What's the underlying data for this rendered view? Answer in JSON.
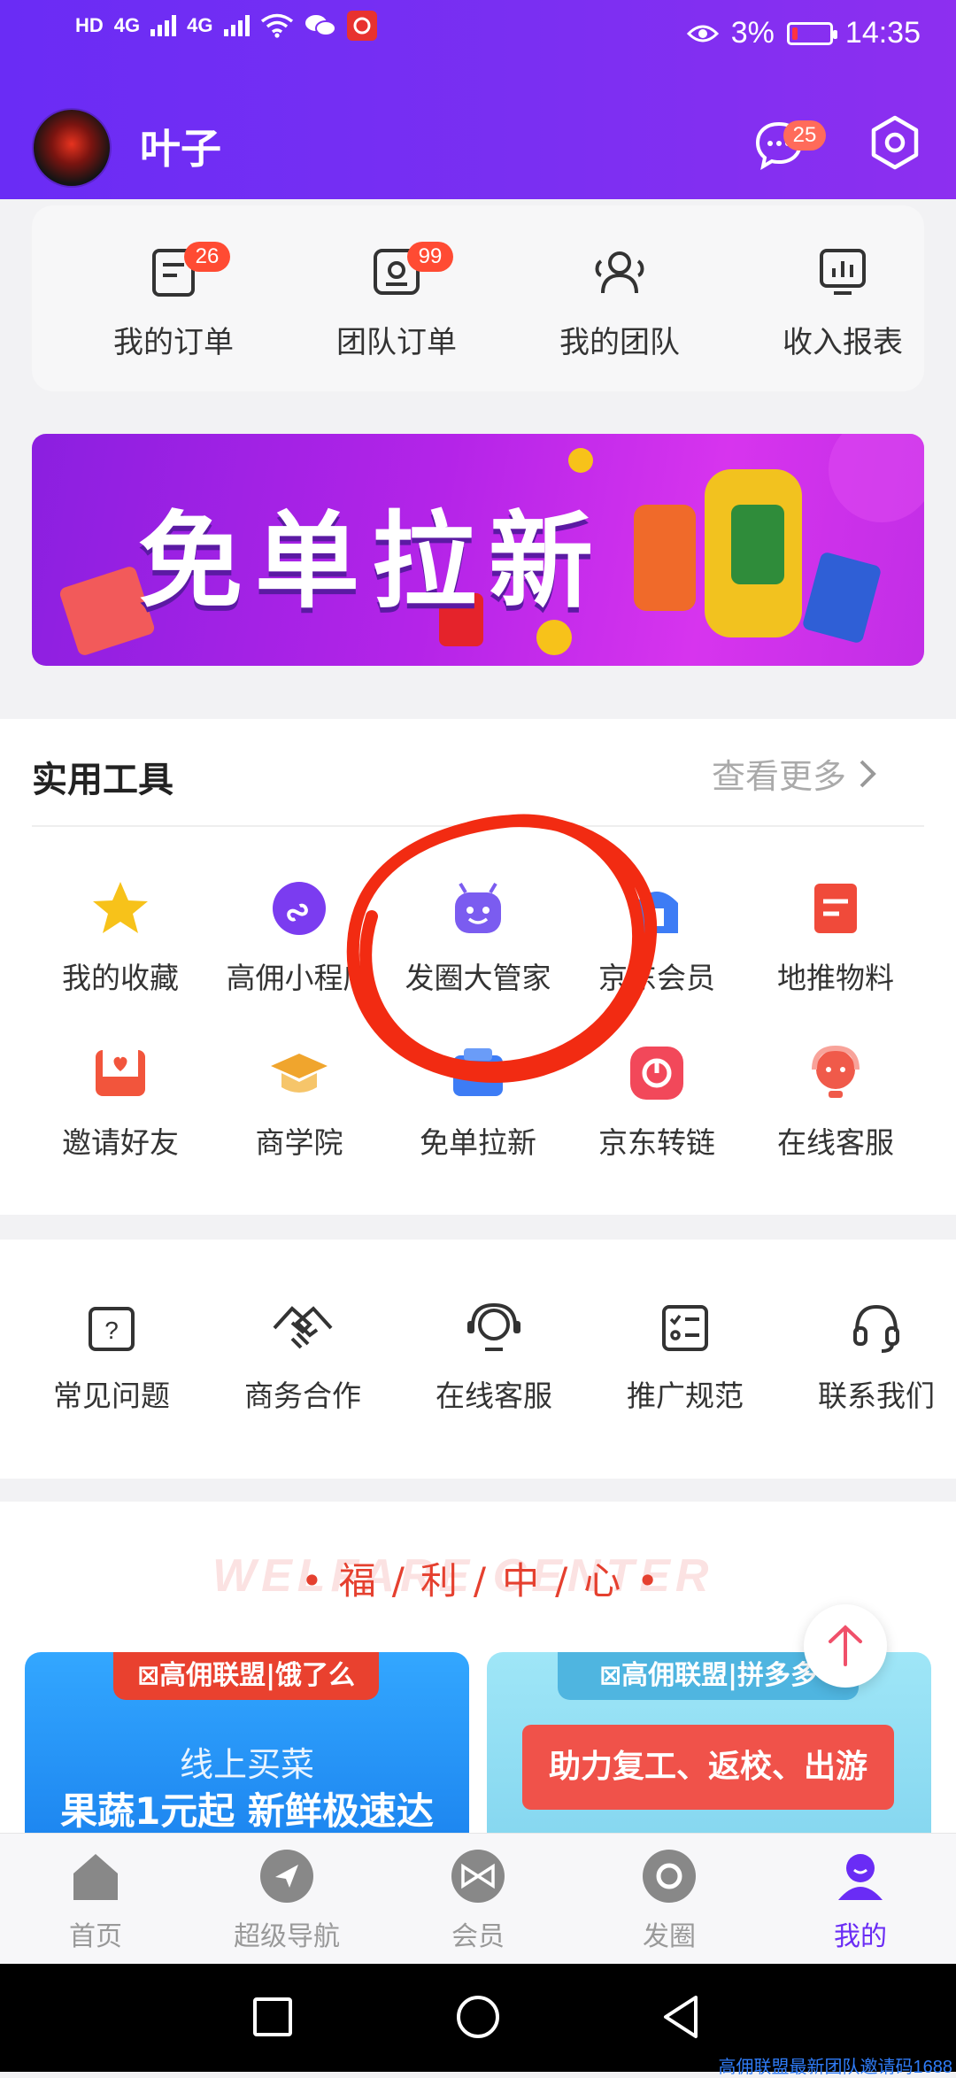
{
  "status_bar": {
    "network": [
      "HD",
      "4G",
      "4G"
    ],
    "battery": "3%",
    "time": "14:35"
  },
  "header": {
    "username": "叶子",
    "message_count": "25"
  },
  "orders": [
    {
      "label": "我的订单",
      "badge": "26",
      "icon": "order-icon"
    },
    {
      "label": "团队订单",
      "badge": "99",
      "icon": "team-order-icon"
    },
    {
      "label": "我的团队",
      "badge": "",
      "icon": "team-icon"
    },
    {
      "label": "收入报表",
      "badge": "",
      "icon": "report-icon"
    }
  ],
  "banner": {
    "title": "免单拉新"
  },
  "tools": {
    "title": "实用工具",
    "more": "查看更多",
    "items": [
      {
        "label": "我的收藏",
        "icon": "star-icon",
        "color": "#f7c21a"
      },
      {
        "label": "高佣小程序",
        "icon": "mini-program-icon",
        "color": "#7b3cf0"
      },
      {
        "label": "发圈大管家",
        "icon": "robot-icon",
        "color": "#7b5cf0"
      },
      {
        "label": "京东会员",
        "icon": "member-icon",
        "color": "#3d7cf5"
      },
      {
        "label": "地推物料",
        "icon": "material-icon",
        "color": "#f04a3a"
      },
      {
        "label": "邀请好友",
        "icon": "invite-icon",
        "color": "#f2553c"
      },
      {
        "label": "商学院",
        "icon": "graduation-cap-icon",
        "color": "#f0a52d"
      },
      {
        "label": "免单拉新",
        "icon": "free-order-icon",
        "color": "#3d7cf5"
      },
      {
        "label": "京东转链",
        "icon": "link-icon",
        "color": "#f2485a"
      },
      {
        "label": "在线客服",
        "icon": "support-agent-icon",
        "color": "#f05a4a"
      }
    ]
  },
  "help": [
    {
      "label": "常见问题",
      "icon": "faq-icon"
    },
    {
      "label": "商务合作",
      "icon": "handshake-icon"
    },
    {
      "label": "在线客服",
      "icon": "customer-service-icon"
    },
    {
      "label": "推广规范",
      "icon": "checklist-icon"
    },
    {
      "label": "联系我们",
      "icon": "headset-icon"
    }
  ],
  "welfare": {
    "bg_text": "WELFARE CENTER",
    "title": "•福/利/中/心•",
    "promos": [
      {
        "tag": "⊠高佣联盟|饿了么",
        "line1": "线上买菜",
        "line2": "果蔬1元起 新鲜极速达"
      },
      {
        "tag": "⊠高佣联盟|拼多多",
        "line1": "助力复工、返校、出游"
      }
    ]
  },
  "bottom_nav": [
    {
      "label": "首页",
      "icon": "home-icon"
    },
    {
      "label": "超级导航",
      "icon": "navigation-icon"
    },
    {
      "label": "会员",
      "icon": "member-badge-icon"
    },
    {
      "label": "发圈",
      "icon": "circle-icon"
    },
    {
      "label": "我的",
      "icon": "profile-icon",
      "active": true
    }
  ],
  "watermark": "高佣联盟最新团队邀请码1688",
  "colors": {
    "primary": "#6a2cf5",
    "accent_red": "#e5402f"
  }
}
